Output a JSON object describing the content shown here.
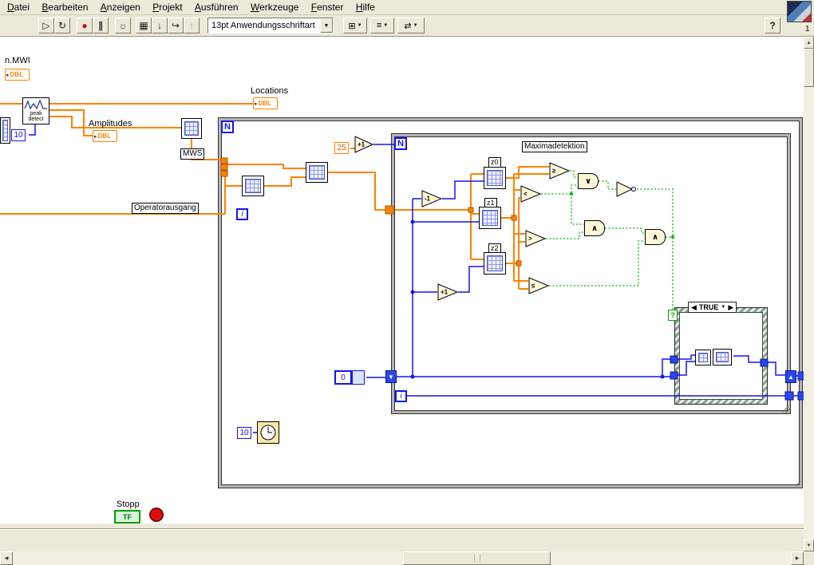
{
  "menubar": {
    "items": [
      "Datei",
      "Bearbeiten",
      "Anzeigen",
      "Projekt",
      "Ausführen",
      "Werkzeuge",
      "Fenster",
      "Hilfe"
    ]
  },
  "toolbar": {
    "font_selector": "13pt Anwendungsschriftart",
    "help_label": "?",
    "window_badge": "1"
  },
  "icons": {
    "run": "▷",
    "run_continuous": "↻",
    "abort": "●",
    "pause": "∥",
    "highlight_execution": "☼",
    "retain_wire_values": "▦",
    "step_into": "↓",
    "step_over": "↪",
    "step_out": "↑",
    "dropdown": "▼",
    "align": "⊞",
    "distribute": "≡",
    "reorder": "⇄",
    "terminal_arrow": "▸",
    "sr_down": "▼",
    "sr_up": "▲",
    "scroll_up": "▲",
    "scroll_down": "▼",
    "scroll_left": "◀",
    "scroll_right": "▶"
  },
  "diagram": {
    "labels": {
      "n_mwi": "n.MWI",
      "locations": "Locations",
      "amplitudes": "Amplitudes",
      "mws": "MWS",
      "operatorausgang": "Operatorausgang",
      "maximadetektion": "Maximadetektion",
      "stopp": "Stopp",
      "z0": "z0",
      "z1": "z1",
      "z2": "z2"
    },
    "terminals": {
      "dbl": "DBL",
      "tf": "TF",
      "loop_count": "N",
      "loop_index": "i"
    },
    "constants": {
      "window_size": "25",
      "left_10": "10",
      "wait_ms": "10",
      "array_zero": "0"
    },
    "nodes": {
      "peak_detect_line1": "peak",
      "peak_detect_line2": "detect",
      "increment_top": "+1",
      "decrement": "-1",
      "increment": "+1",
      "ge": "≥",
      "lt": "<",
      "gt": ">",
      "le": "≤",
      "or": "∨",
      "and": "∧"
    },
    "case": {
      "selector_left": "◀",
      "selector_value": "TRUE",
      "selector_dropdown": "▼",
      "selector_right": "▶",
      "question": "?"
    }
  }
}
